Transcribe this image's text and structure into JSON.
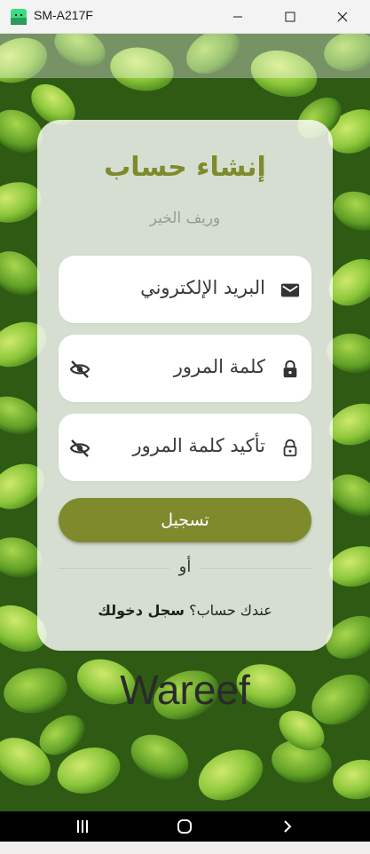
{
  "window": {
    "title": "SM-A217F",
    "icon": "android-app-icon",
    "controls": [
      "minimize-icon",
      "maximize-icon",
      "close-icon"
    ]
  },
  "card": {
    "title": "إنشاء حساب",
    "subtitle": "وريف الخير",
    "email": {
      "text": "البريد الإلكتروني",
      "icon": "mail-icon"
    },
    "password": {
      "text": "كلمة المرور",
      "icon": "lock-icon",
      "toggle_icon": "eye-off-icon"
    },
    "confirm_password": {
      "text": "تأكيد كلمة المرور",
      "icon": "lock-outline-icon",
      "toggle_icon": "eye-off-icon"
    },
    "register_label": "تسجيل",
    "or_label": "أو",
    "have_account_text": "عندك حساب؟ ",
    "login_link": "سجل دخولك"
  },
  "brand": "Wareef",
  "navbar": {
    "icons": [
      "recents-icon",
      "home-icon",
      "back-icon"
    ]
  },
  "colors": {
    "accent": "#7f8a2c",
    "card_bg": "#ffffff",
    "navbar": "#000000"
  }
}
